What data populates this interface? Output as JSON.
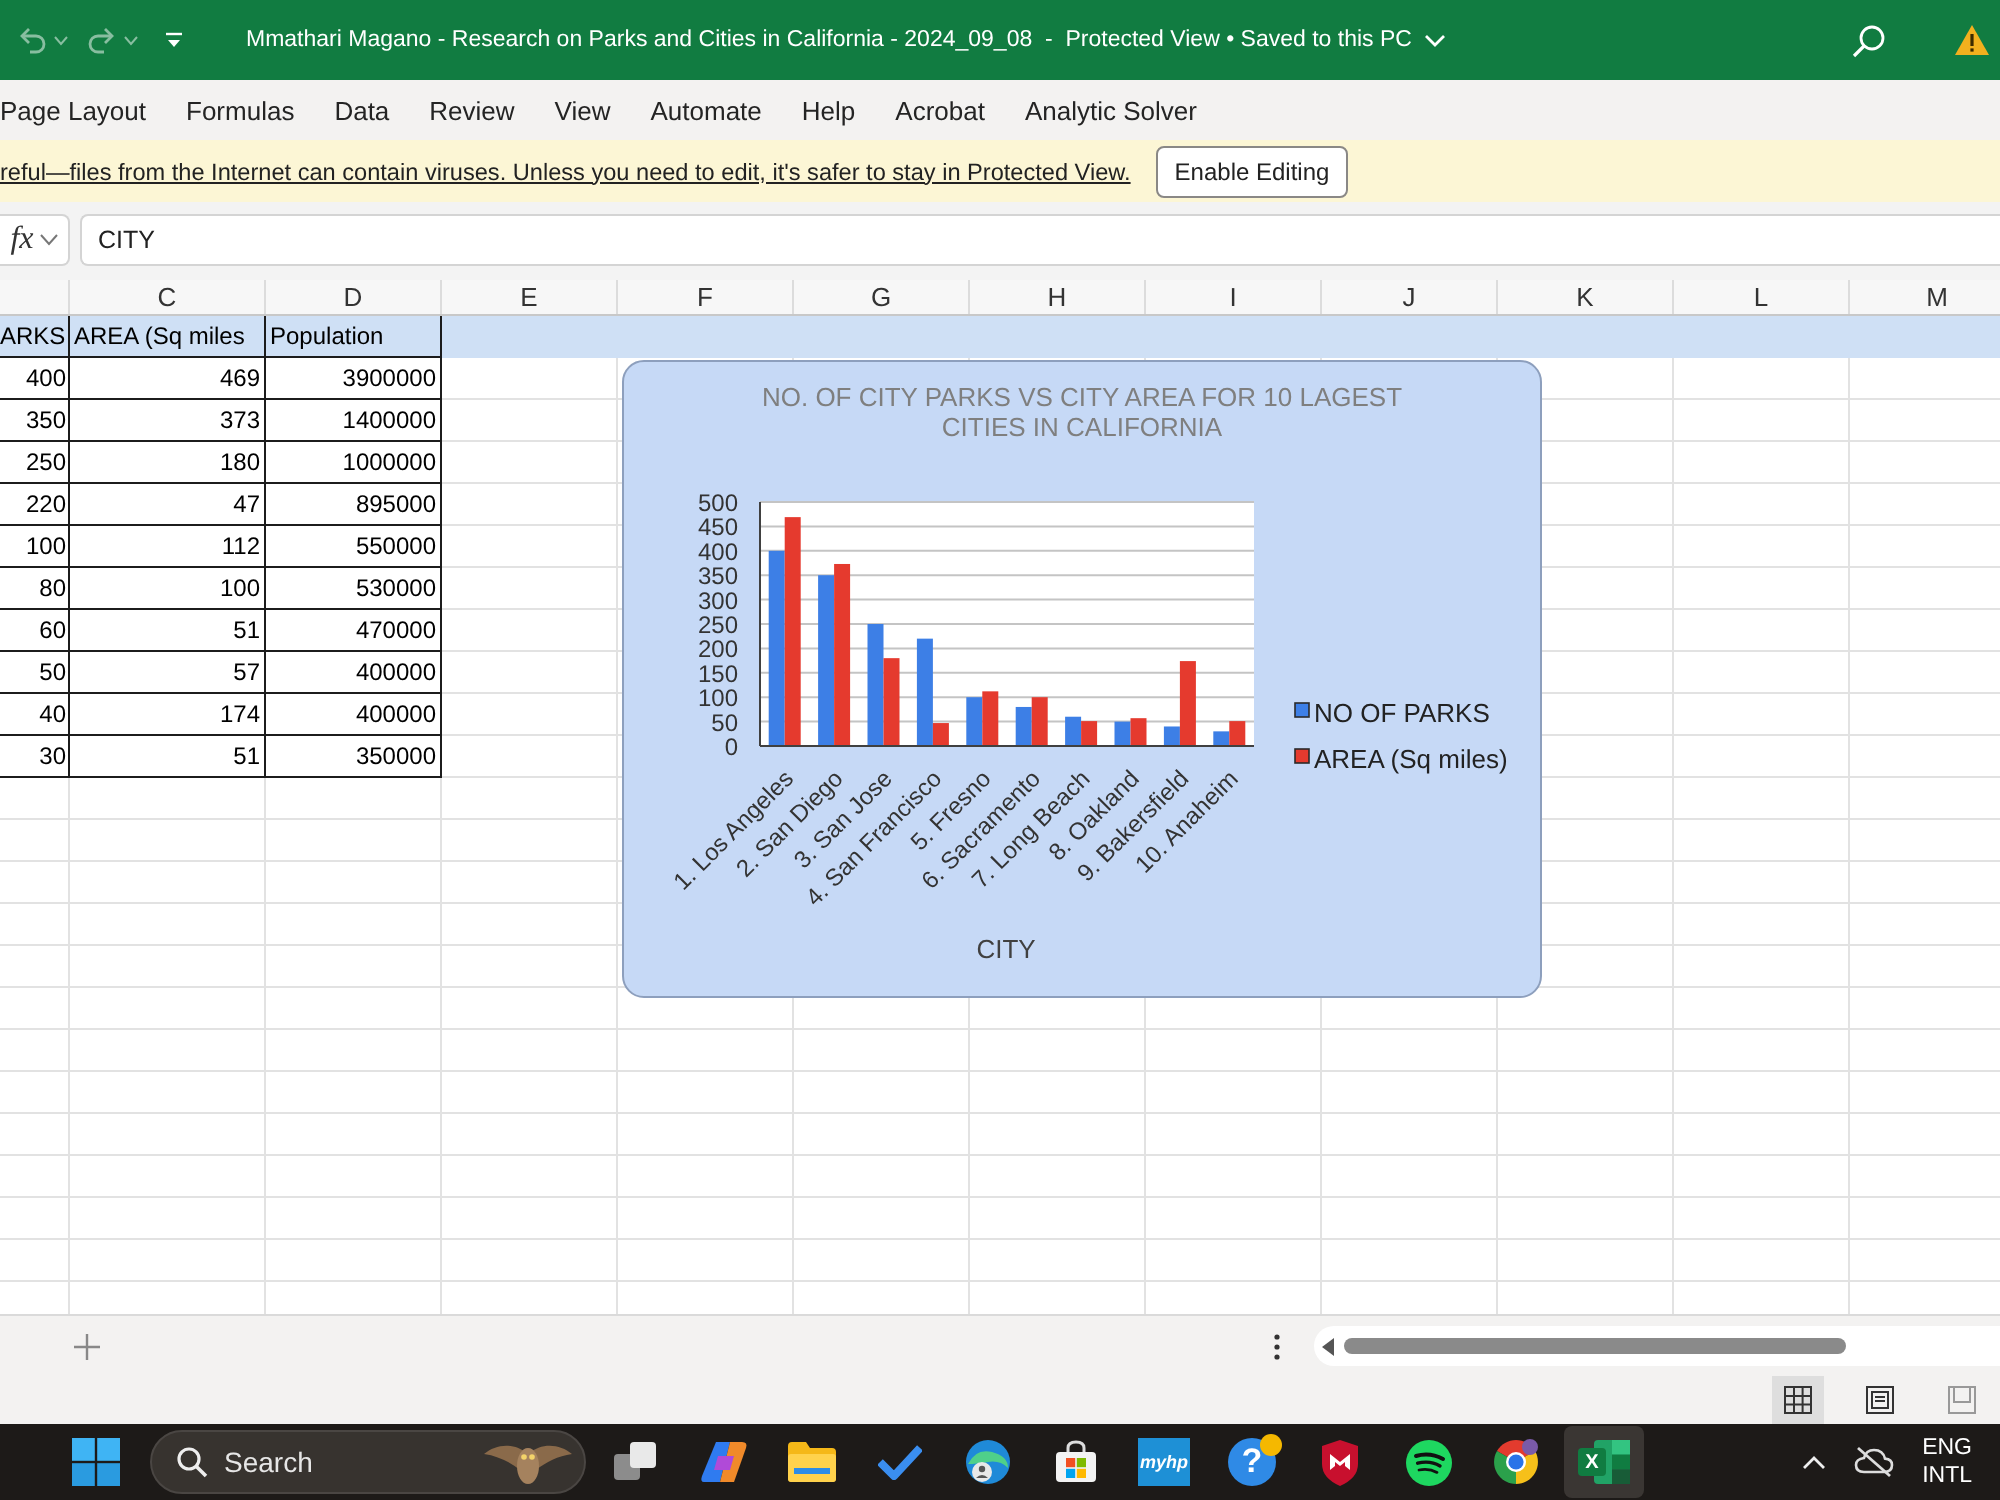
{
  "title_bar": {
    "quick_access": [
      {
        "kind": "undo",
        "disabled": true
      },
      {
        "kind": "redo",
        "disabled": true
      }
    ],
    "title": "Mmathari Magano - Research on Parks and Cities in California - 2024_09_08  -  Protected View • Saved to this PC"
  },
  "menu": [
    {
      "label": "Page Layout",
      "selected": false
    },
    {
      "label": "Formulas",
      "selected": false
    },
    {
      "label": "Data",
      "selected": false
    },
    {
      "label": "Review",
      "selected": false
    },
    {
      "label": "View",
      "selected": false
    },
    {
      "label": "Automate",
      "selected": false
    },
    {
      "label": "Help",
      "selected": false
    },
    {
      "label": "Acrobat",
      "selected": false
    },
    {
      "label": "Analytic Solver",
      "selected": false
    }
  ],
  "protected_view": {
    "message": "reful—files from the Internet can contain viruses. Unless you need to edit, it's safer to stay in Protected View.",
    "button": "Enable Editing"
  },
  "formula_bar": {
    "function_label": "fx",
    "value": "CITY"
  },
  "sheet": {
    "columns": [
      "C",
      "D",
      "E",
      "F",
      "G",
      "H",
      "I",
      "J",
      "K",
      "L",
      "M"
    ],
    "rows": [
      {
        "kind": "header",
        "selected": true,
        "cells": [
          "ARKS",
          "AREA (Sq miles",
          "Population"
        ]
      },
      {
        "kind": "data",
        "selected": false,
        "cells": [
          "400",
          "469",
          "3900000"
        ]
      },
      {
        "kind": "data",
        "selected": false,
        "cells": [
          "350",
          "373",
          "1400000"
        ]
      },
      {
        "kind": "data",
        "selected": false,
        "cells": [
          "250",
          "180",
          "1000000"
        ]
      },
      {
        "kind": "data",
        "selected": false,
        "cells": [
          "220",
          "47",
          "895000"
        ]
      },
      {
        "kind": "data",
        "selected": false,
        "cells": [
          "100",
          "112",
          "550000"
        ]
      },
      {
        "kind": "data",
        "selected": false,
        "cells": [
          "80",
          "100",
          "530000"
        ]
      },
      {
        "kind": "data",
        "selected": false,
        "cells": [
          "60",
          "51",
          "470000"
        ]
      },
      {
        "kind": "data",
        "selected": false,
        "cells": [
          "50",
          "57",
          "400000"
        ]
      },
      {
        "kind": "data",
        "selected": false,
        "cells": [
          "40",
          "174",
          "400000"
        ]
      },
      {
        "kind": "data",
        "selected": false,
        "cells": [
          "30",
          "51",
          "350000"
        ]
      }
    ],
    "chart_data": [
      {
        "type": "bar",
        "title": "NO. OF CITY PARKS VS CITY AREA FOR 10 LAGEST CITIES IN CALIFORNIA",
        "xlabel": "CITY",
        "categories": [
          "1. Los Angeles",
          "2. San Diego",
          "3. San Jose",
          "4. San Francisco",
          "5. Fresno",
          "6. Sacramento",
          "7. Long Beach",
          "8. Oakland",
          "9. Bakersfield",
          "10. Anaheim"
        ],
        "series": [
          {
            "name": "NO OF PARKS",
            "color": "#3d7fe6",
            "values": [
              400,
              350,
              250,
              220,
              100,
              80,
              60,
              50,
              40,
              30
            ]
          },
          {
            "name": "AREA (Sq miles)",
            "color": "#e53a2e",
            "values": [
              469,
              373,
              180,
              47,
              112,
              100,
              51,
              57,
              174,
              51
            ]
          }
        ],
        "ylim": [
          0,
          500
        ],
        "yticks": [
          0,
          50,
          100,
          150,
          200,
          250,
          300,
          350,
          400,
          450,
          500
        ],
        "grid": true,
        "legend": "right"
      }
    ]
  },
  "status_bar": {
    "views": [
      {
        "kind": "normal",
        "selected": true
      },
      {
        "kind": "page_layout",
        "selected": false
      },
      {
        "kind": "page_break",
        "selected": false
      }
    ]
  },
  "taskbar": {
    "search_placeholder": "Search",
    "apps": [
      {
        "kind": "window_stack",
        "active": false
      },
      {
        "kind": "ribbon",
        "active": false
      },
      {
        "kind": "folder",
        "active": false
      },
      {
        "kind": "check",
        "active": false
      },
      {
        "kind": "wave_circle",
        "active": false
      },
      {
        "kind": "bag",
        "active": false
      },
      {
        "kind": "tile_text",
        "label": "myhp",
        "active": false
      },
      {
        "kind": "help_circle",
        "label": "?",
        "active": false
      },
      {
        "kind": "shield",
        "active": false
      },
      {
        "kind": "sound_circle",
        "active": false
      },
      {
        "kind": "segmented_circle",
        "active": false
      },
      {
        "kind": "sheet",
        "label": "X",
        "active": true
      }
    ],
    "tray": {
      "language": "ENG",
      "layout": "INTL"
    }
  }
}
